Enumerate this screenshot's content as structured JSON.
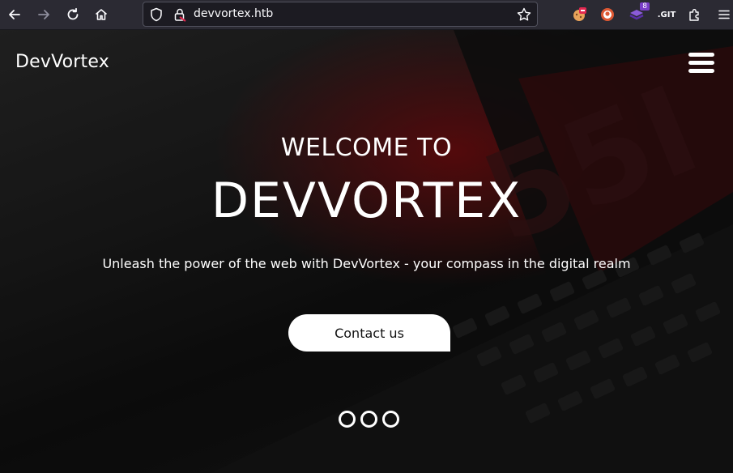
{
  "browser": {
    "url": "devvortex.htb",
    "extensions": [
      {
        "name": "extension-icon-1"
      },
      {
        "name": "extension-icon-2"
      },
      {
        "name": "extension-icon-3",
        "badge": "8"
      },
      {
        "name": "extension-icon-4",
        "label": ".GIT"
      }
    ]
  },
  "site": {
    "brand": "DevVortex",
    "hero": {
      "welcome": "WELCOME TO",
      "title": "DEVVORTEX",
      "tagline": "Unleash the power of the web with DevVortex - your compass in the digital realm",
      "cta_label": "Contact us"
    },
    "carousel": {
      "slides": 3
    }
  },
  "colors": {
    "toolbar_bg": "#2b2a33",
    "accent_red": "#8c0a0e",
    "white": "#ffffff"
  }
}
